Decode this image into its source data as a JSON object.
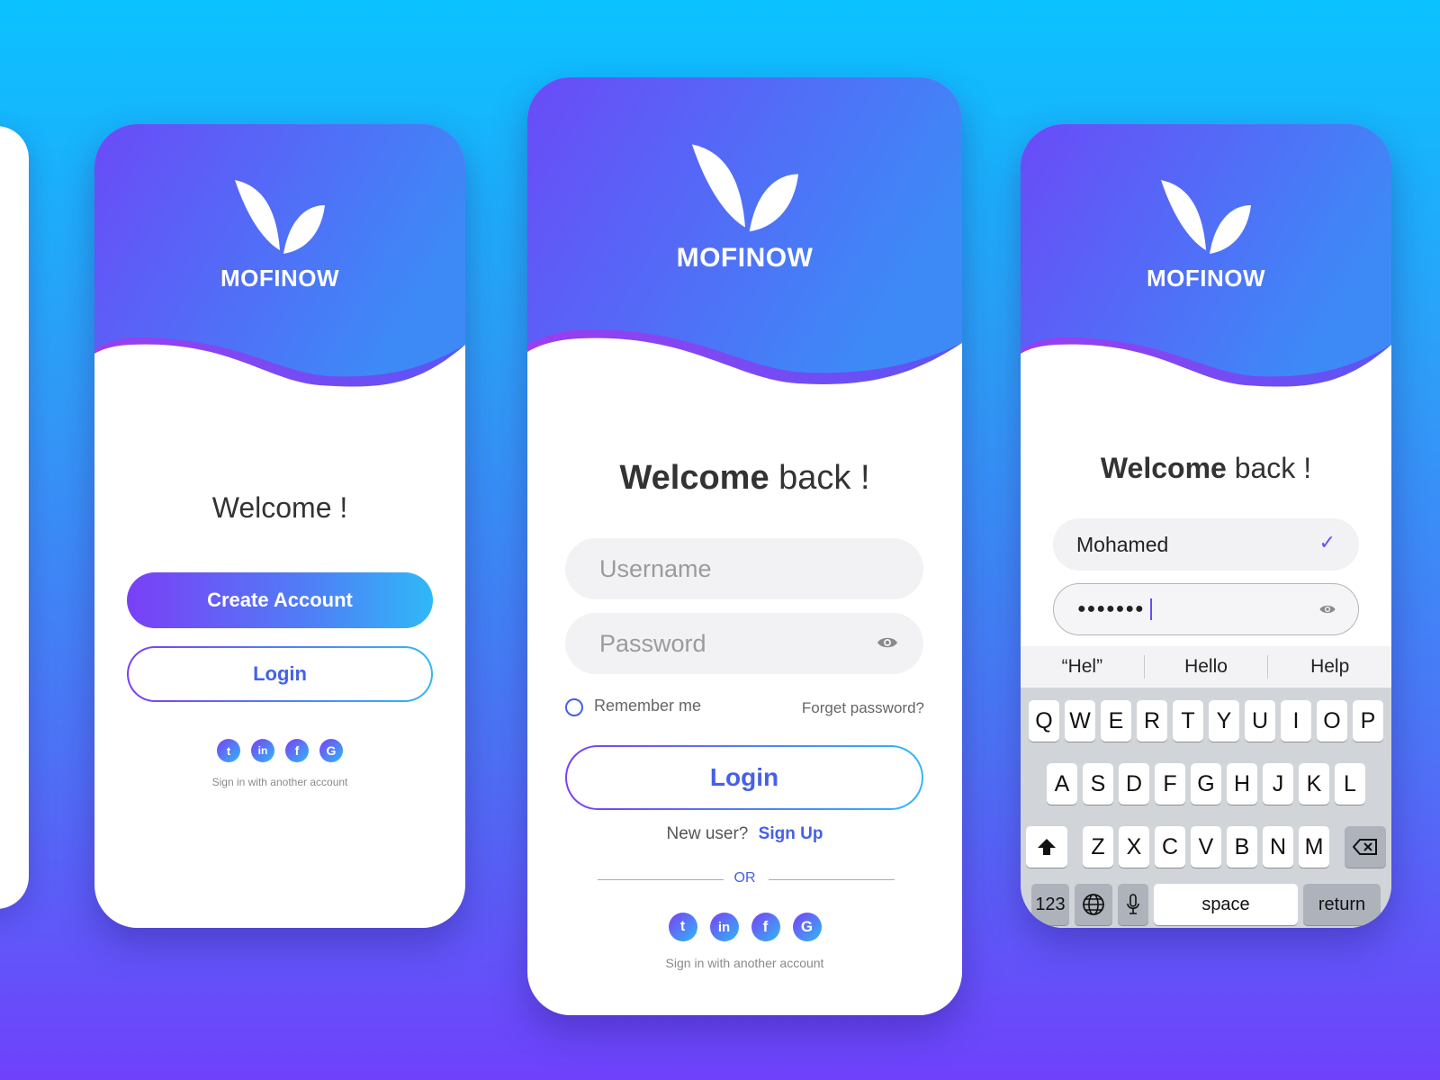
{
  "brand": {
    "name": "MOFINOW"
  },
  "screen_welcome": {
    "title": "Welcome !",
    "create_account": "Create Account",
    "login": "Login",
    "social_icons": [
      "twitter-icon",
      "linkedin-icon",
      "facebook-icon",
      "google-icon"
    ],
    "social_glyphs": [
      "t",
      "in",
      "f",
      "G"
    ],
    "social_caption": "Sign in with another account"
  },
  "screen_login": {
    "title_bold": "Welcome",
    "title_rest": " back !",
    "username_placeholder": "Username",
    "password_placeholder": "Password",
    "remember_me": "Remember me",
    "forgot": "Forget password?",
    "login": "Login",
    "new_user": "New user?",
    "sign_up": "Sign Up",
    "or": "OR",
    "social_caption": "Sign in with another account"
  },
  "screen_typing": {
    "title_bold": "Welcome",
    "title_rest": " back !",
    "username_value": "Mohamed",
    "password_masked": "●●●●●●●",
    "suggestions": [
      "“Hel”",
      "Hello",
      "Help"
    ],
    "row1": [
      "Q",
      "W",
      "E",
      "R",
      "T",
      "Y",
      "U",
      "I",
      "O",
      "P"
    ],
    "row2": [
      "A",
      "S",
      "D",
      "F",
      "G",
      "H",
      "J",
      "K",
      "L"
    ],
    "row3": [
      "Z",
      "X",
      "C",
      "V",
      "B",
      "N",
      "M"
    ],
    "key_123": "123",
    "key_space": "space",
    "key_return": "return"
  },
  "colors": {
    "accent": "#4560e8",
    "purple": "#7a3ff6",
    "cyan": "#2fb8f7"
  }
}
